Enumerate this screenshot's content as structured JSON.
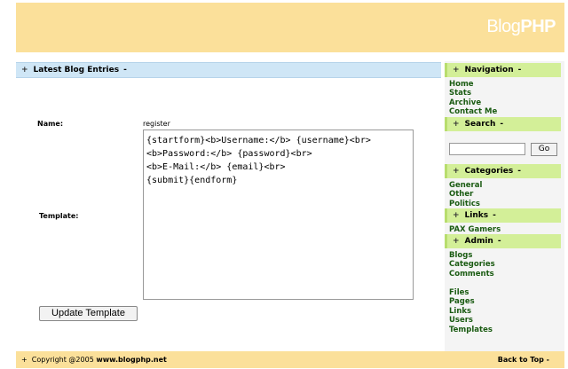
{
  "header": {
    "logo_light": "Blog",
    "logo_bold": "PHP"
  },
  "main": {
    "bar_plus": "+",
    "bar_title": "Latest Blog Entries",
    "bar_dash": "-",
    "name_label": "Name:",
    "name_value": "register",
    "template_label": "Template:",
    "template_text": "{startform}<b>Username:</b> {username}<br>\n<b>Password:</b> {password}<br>\n<b>E-Mail:</b> {email}<br>\n{submit}{endform}",
    "update_button": "Update Template"
  },
  "footer": {
    "plus": "+",
    "copyright": "Copyright @2005",
    "site": "www.blogphp.net",
    "back_to_top": "Back to Top",
    "dash": "-"
  },
  "sidebar": {
    "plus": "+",
    "dash": "-",
    "navigation": {
      "title": "Navigation",
      "items": [
        "Home",
        "Stats",
        "Archive",
        "Contact Me"
      ]
    },
    "search": {
      "title": "Search",
      "input_value": "",
      "go_label": "Go"
    },
    "categories": {
      "title": "Categories",
      "items": [
        "General",
        "Other",
        "Politics"
      ]
    },
    "links": {
      "title": "Links",
      "items": [
        "PAX Gamers"
      ]
    },
    "admin": {
      "title": "Admin",
      "items": [
        "Blogs",
        "Categories",
        "Comments",
        "Files",
        "Pages",
        "Links",
        "Users",
        "Templates"
      ]
    }
  },
  "colors": {
    "header_bg": "#fbe09a",
    "mainbar_bg": "#cfe6f6",
    "sidebar_head_bg": "#d3ef98",
    "link_green": "#1a5b12"
  }
}
